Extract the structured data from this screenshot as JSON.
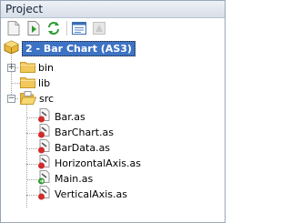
{
  "panel": {
    "title": "Project"
  },
  "toolbar": {
    "buttons": [
      {
        "icon": "new-file-icon"
      },
      {
        "icon": "add-file-icon"
      },
      {
        "icon": "refresh-icon"
      },
      {
        "icon": "properties-icon"
      },
      {
        "icon": "disabled-tool-icon"
      }
    ]
  },
  "tree": {
    "root": {
      "label": "2 - Bar Chart (AS3)",
      "icon": "project-icon",
      "selected": true
    },
    "folders": {
      "bin": {
        "label": "bin",
        "expanded": false
      },
      "lib": {
        "label": "lib"
      },
      "src": {
        "label": "src",
        "expanded": true
      }
    },
    "files": [
      {
        "label": "Bar.as"
      },
      {
        "label": "BarChart.as"
      },
      {
        "label": "BarData.as"
      },
      {
        "label": "HorizontalAxis.as"
      },
      {
        "label": "Main.as"
      },
      {
        "label": "VerticalAxis.as"
      }
    ]
  },
  "colors": {
    "selection": "#3d73c4",
    "folder": "#f2c75c",
    "file_badge": "#d22b2b"
  }
}
